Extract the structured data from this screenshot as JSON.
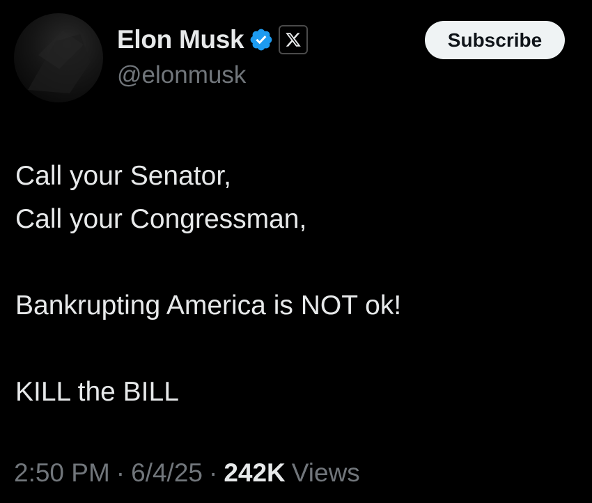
{
  "author": {
    "display_name": "Elon Musk",
    "handle": "@elonmusk",
    "verified_icon": "verified-badge-icon",
    "affiliate_icon": "x-logo-icon"
  },
  "subscribe_button": {
    "label": "Subscribe"
  },
  "tweet": {
    "lines": [
      "Call your Senator,",
      "Call your Congressman,",
      "",
      "Bankrupting America is NOT ok!",
      "",
      "KILL the BILL"
    ]
  },
  "meta": {
    "time": "2:50 PM",
    "separator": "·",
    "date": "6/4/25",
    "views_count": "242K",
    "views_label": "Views"
  },
  "colors": {
    "background": "#000000",
    "primary_text": "#e7e9ea",
    "secondary_text": "#71767b",
    "verified_blue": "#1d9bf0",
    "button_bg": "#eff3f4"
  }
}
